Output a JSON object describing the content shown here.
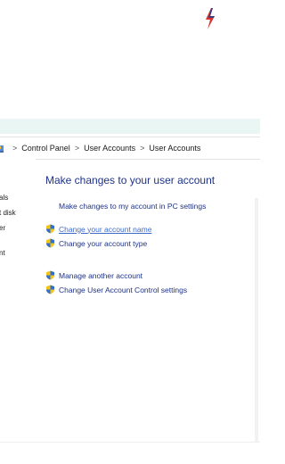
{
  "window": {
    "breadcrumb": [
      "Control Panel",
      "User Accounts",
      "User Accounts"
    ],
    "separator": ">"
  },
  "logo": {
    "line1": "",
    "line2": ""
  },
  "left_pane": {
    "items": [
      "als",
      "t disk",
      "er",
      "nt"
    ]
  },
  "main": {
    "title": "Make changes to your user account",
    "pc_settings_link": "Make changes to my account in PC settings",
    "links": [
      {
        "label": "Change your account name",
        "icon": "uac-shield-icon",
        "state": "hover"
      },
      {
        "label": "Change your account type",
        "icon": "uac-shield-icon"
      },
      {
        "label": "Manage another account",
        "icon": "uac-shield-icon"
      },
      {
        "label": "Change User Account Control settings",
        "icon": "uac-shield-icon"
      }
    ]
  },
  "colors": {
    "link": "#1e3287",
    "link_hover": "#3e6bc9",
    "band": "#e9f6f4"
  }
}
